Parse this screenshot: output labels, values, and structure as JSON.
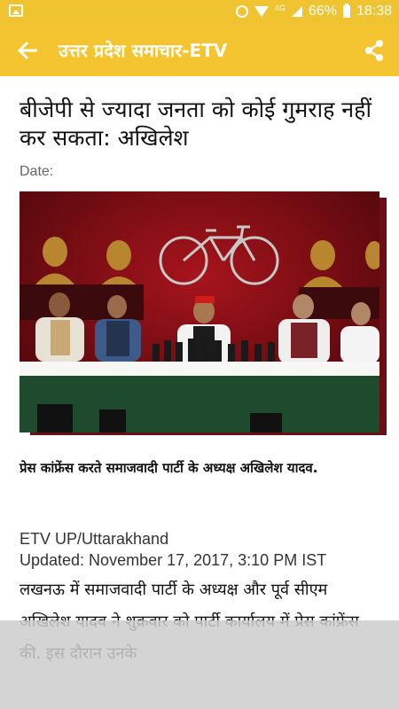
{
  "status_bar": {
    "network": "4G",
    "battery": "66%",
    "time": "18:38"
  },
  "app_bar": {
    "title": "उत्तर प्रदेश समाचार-ETV"
  },
  "article": {
    "headline": "बीजेपी से ज्यादा जनता को कोई गुमराह नहीं कर सकता: अखिलेश",
    "date_label": "Date:",
    "caption": "प्रेस कांफ्रेंस करते समाजवादी पार्टी के अध्यक्ष अखिलेश यादव.",
    "source": "ETV UP/Uttarakhand",
    "updated": "Updated: November 17, 2017, 3:10 PM IST",
    "body": "लखनऊ में समाजवादी पार्टी के अध्यक्ष और पूर्व सीएम अखिलेश यादव ने शुक्रवार को पार्टी कार्यालय में प्रेस कांफ्रेंस की. इस दौरान उनके"
  },
  "colors": {
    "app_bar": "#f4c531",
    "status_bar": "#f0c430",
    "photo_backdrop": "#8a1018"
  },
  "icons": {
    "back": "arrow-left-icon",
    "share": "share-icon"
  }
}
